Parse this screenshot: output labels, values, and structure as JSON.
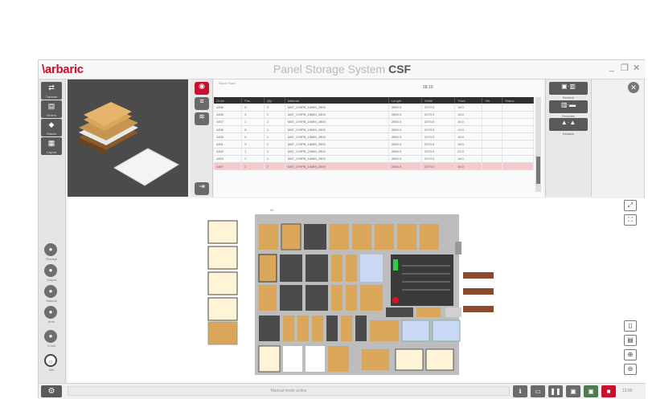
{
  "app": {
    "logo": "\\arbaric",
    "title_light": "Panel Storage System ",
    "title_bold": "CSF",
    "window_controls": [
      "_",
      "❐",
      "✕"
    ]
  },
  "leftbar": {
    "top_buttons": [
      {
        "icon": "transfer-icon",
        "caption": "Transfer"
      },
      {
        "icon": "document-icon",
        "caption": "Orders"
      },
      {
        "icon": "stack-icon",
        "caption": "Stacks"
      },
      {
        "icon": "layout-icon",
        "caption": "Layout"
      }
    ],
    "round_buttons": [
      {
        "icon": "storage-icon",
        "caption": "Storage"
      },
      {
        "icon": "output-icon",
        "caption": "Output"
      },
      {
        "icon": "manual-icon",
        "caption": "Manual"
      },
      {
        "icon": "auto-icon",
        "caption": "Auto"
      },
      {
        "icon": "count-icon",
        "caption": "Count"
      },
      {
        "icon": "info-icon",
        "caption": "Info"
      }
    ]
  },
  "table": {
    "info_label": "Stack Stack",
    "value": "18.10",
    "columns": [
      "Order",
      "Pos",
      "Qty",
      "Material",
      "Length",
      "Width",
      "Thick",
      "Stk",
      "Status"
    ],
    "rows": [
      [
        "4456",
        "8",
        "2",
        "MAT_CHIPB_18MM_2800",
        "2800.0",
        "2070.0",
        "18.0",
        "",
        ""
      ],
      [
        "4456",
        "4",
        "2",
        "MAT_CHIPB_18MM_2800",
        "2800.0",
        "2070.0",
        "18.0",
        "",
        ""
      ],
      [
        "4457",
        "1",
        "2",
        "MAT_CHIPB_16MM_2800",
        "2800.0",
        "2070.0",
        "16.0",
        "",
        ""
      ],
      [
        "4458",
        "8",
        "1",
        "MAT_CHIPB_19MM_2800",
        "2800.0",
        "2070.0",
        "19.0",
        "",
        ""
      ],
      [
        "4456",
        "5",
        "1",
        "MAT_CHIPB_18MM_2800",
        "2800.0",
        "2070.0",
        "18.0",
        "",
        ""
      ],
      [
        "4461",
        "3",
        "2",
        "MAT_CHIPB_18MM_2800",
        "2800.0",
        "2070.0",
        "18.0",
        "",
        ""
      ],
      [
        "4462",
        "1",
        "1",
        "MAT_CHIPB_22MM_2800",
        "2800.0",
        "2070.0",
        "22.0",
        "",
        ""
      ],
      [
        "4463",
        "2",
        "1",
        "MAT_CHIPB_18MM_2800",
        "2800.0",
        "2070.0",
        "18.0",
        "",
        ""
      ],
      [
        "4457",
        "1",
        "2",
        "MAT_CHIPB_16MM_2800",
        "2800.0",
        "2070.0",
        "16.0",
        "",
        ""
      ]
    ]
  },
  "right_tools": [
    {
      "icon": "move-in-icon",
      "caption": "Restock"
    },
    {
      "icon": "move-between-icon",
      "caption": "Relocate"
    },
    {
      "icon": "move-out-icon",
      "caption": "Destack"
    }
  ],
  "main": {
    "grid_label": "A1"
  },
  "statusbar": {
    "message": "Manual mode active",
    "clock": "12:00"
  },
  "colors": {
    "brand": "#c8102e",
    "selected_row": "#f7c8cd",
    "dark_button": "#58595b",
    "wood": "#d9a65a",
    "dark_slot": "#4a4a4a",
    "blue_slot": "#c9d9f3"
  }
}
